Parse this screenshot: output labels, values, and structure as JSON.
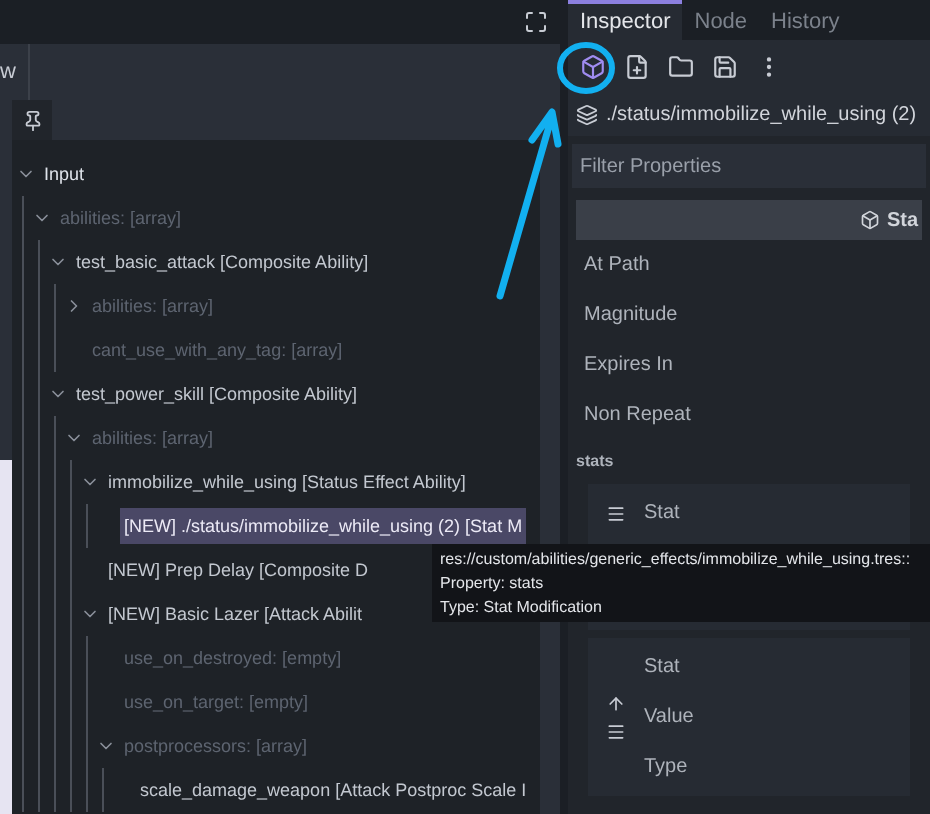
{
  "left_panel": {
    "tab_label": "w"
  },
  "tree": [
    {
      "text": "Input",
      "kind": "root",
      "expanded": true,
      "selected": false,
      "children": [
        {
          "text": "abilities: [array]",
          "kind": "property",
          "expanded": true,
          "selected": false,
          "children": [
            {
              "text": "test_basic_attack [Composite Ability]",
              "kind": "resource",
              "expanded": true,
              "selected": false,
              "children": [
                {
                  "text": "abilities: [array]",
                  "kind": "property",
                  "expanded": false,
                  "selected": false
                },
                {
                  "text": "cant_use_with_any_tag: [array]",
                  "kind": "property",
                  "selected": false
                }
              ]
            },
            {
              "text": "test_power_skill [Composite Ability]",
              "kind": "resource",
              "expanded": true,
              "selected": false,
              "children": [
                {
                  "text": "abilities: [array]",
                  "kind": "property",
                  "expanded": true,
                  "selected": false,
                  "children": [
                    {
                      "text": "immobilize_while_using [Status Effect Ability]",
                      "kind": "resource",
                      "expanded": true,
                      "selected": false,
                      "children": [
                        {
                          "text": "[NEW] ./status/immobilize_while_using (2) [Stat M",
                          "kind": "resource",
                          "selected": true
                        }
                      ]
                    },
                    {
                      "text": "[NEW] Prep Delay [Composite D",
                      "kind": "resource",
                      "selected": false
                    },
                    {
                      "text": "[NEW] Basic Lazer [Attack Abilit",
                      "kind": "resource",
                      "expanded": true,
                      "selected": false,
                      "children": [
                        {
                          "text": "use_on_destroyed: [empty]",
                          "kind": "property",
                          "selected": false
                        },
                        {
                          "text": "use_on_target: [empty]",
                          "kind": "property",
                          "selected": false
                        },
                        {
                          "text": "postprocessors: [array]",
                          "kind": "property",
                          "expanded": true,
                          "selected": false,
                          "children": [
                            {
                              "text": "scale_damage_weapon [Attack Postproc Scale I",
                              "kind": "resource",
                              "selected": false
                            }
                          ]
                        }
                      ]
                    }
                  ]
                }
              ]
            }
          ]
        }
      ]
    }
  ],
  "tooltip": {
    "lines": [
      "res://custom/abilities/generic_effects/immobilize_while_using.tres::",
      "Property: stats",
      "Type: Stat Modification"
    ]
  },
  "inspector": {
    "tabs": [
      {
        "label": "Inspector",
        "selected": true
      },
      {
        "label": "Node",
        "selected": false
      },
      {
        "label": "History",
        "selected": false
      }
    ],
    "resource_path": "./status/immobilize_while_using (2)",
    "filter": {
      "placeholder": "Filter Properties"
    },
    "section_title": "Sta",
    "properties": [
      "At Path",
      "Magnitude",
      "Expires In",
      "Non Repeat"
    ],
    "group_label": "stats",
    "elements": [
      {
        "fields": [
          "Stat"
        ],
        "move_up": false
      },
      {
        "fields": [
          "Stat",
          "Value",
          "Type"
        ],
        "move_up": true
      }
    ]
  }
}
